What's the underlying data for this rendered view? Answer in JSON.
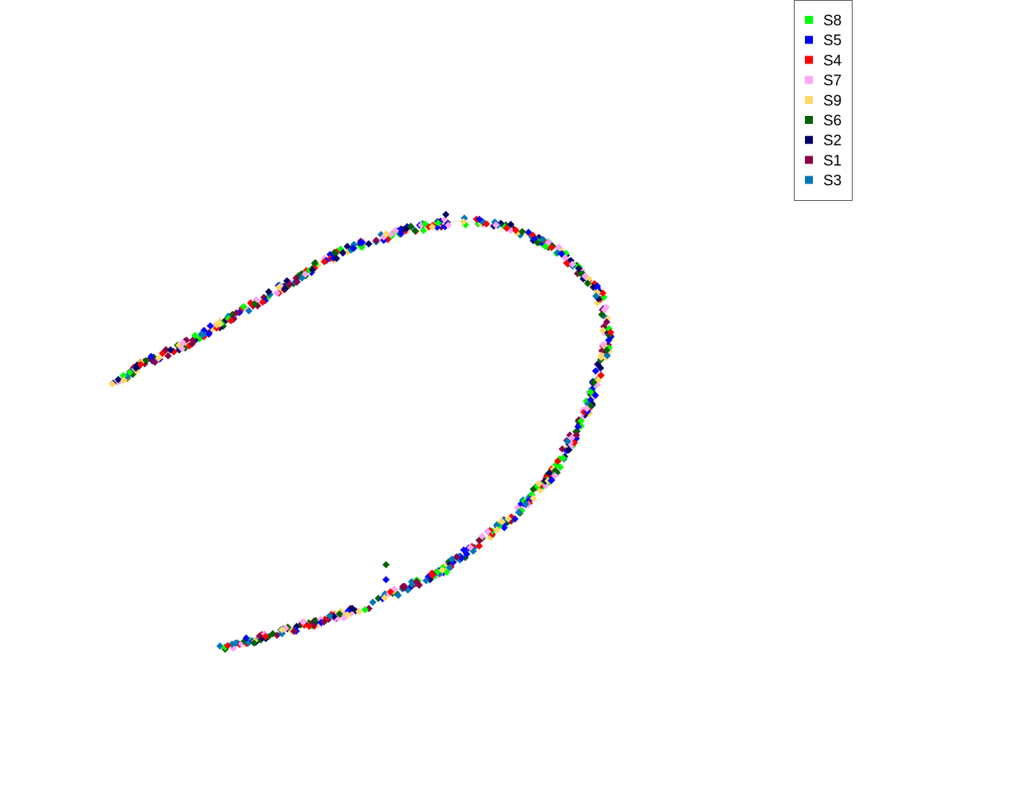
{
  "chart_data": {
    "type": "scatter",
    "title": "",
    "xlabel": "",
    "ylabel": "",
    "axes_visible": false,
    "grid": false,
    "legend_position": "top-right",
    "marker": "diamond",
    "xlim": [
      -1.0,
      1.0
    ],
    "ylim": [
      -1.0,
      1.0
    ],
    "series": [
      {
        "name": "S8",
        "color": "#00ff00"
      },
      {
        "name": "S5",
        "color": "#0000ff"
      },
      {
        "name": "S4",
        "color": "#ff0000"
      },
      {
        "name": "S7",
        "color": "#ffa6f5"
      },
      {
        "name": "S9",
        "color": "#ffd966"
      },
      {
        "name": "S6",
        "color": "#006400"
      },
      {
        "name": "S2",
        "color": "#000066"
      },
      {
        "name": "S1",
        "color": "#8b0045"
      },
      {
        "name": "S3",
        "color": "#0077bb"
      }
    ],
    "curve_path": [
      [
        -0.95,
        0.0
      ],
      [
        -0.85,
        0.07
      ],
      [
        -0.7,
        0.15
      ],
      [
        -0.55,
        0.25
      ],
      [
        -0.4,
        0.35
      ],
      [
        -0.25,
        0.45
      ],
      [
        -0.05,
        0.52
      ],
      [
        0.1,
        0.55
      ],
      [
        0.25,
        0.53
      ],
      [
        0.4,
        0.45
      ],
      [
        0.52,
        0.32
      ],
      [
        0.55,
        0.15
      ],
      [
        0.48,
        -0.1
      ],
      [
        0.38,
        -0.3
      ],
      [
        0.25,
        -0.45
      ],
      [
        0.05,
        -0.62
      ],
      [
        -0.2,
        -0.75
      ],
      [
        -0.45,
        -0.83
      ],
      [
        -0.62,
        -0.88
      ]
    ],
    "spread": 0.012,
    "points_per_series": 80,
    "outliers": [
      {
        "series": "S6",
        "x": -0.12,
        "y": -0.6
      },
      {
        "series": "S5",
        "x": -0.12,
        "y": -0.65
      },
      {
        "series": "S2",
        "x": 0.06,
        "y": 0.57
      }
    ]
  }
}
